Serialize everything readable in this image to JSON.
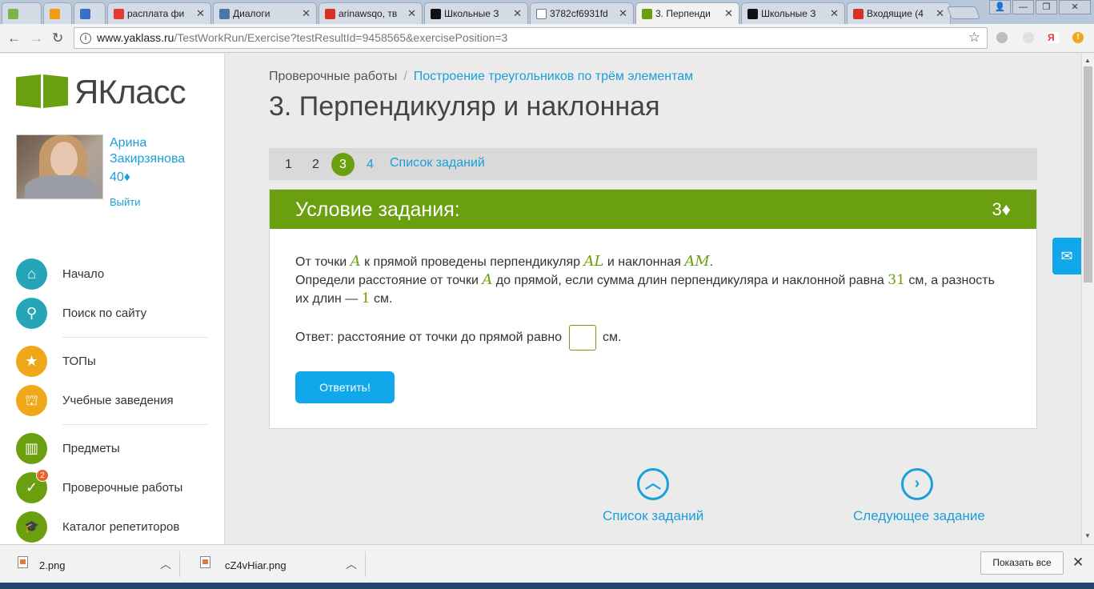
{
  "browser": {
    "tabs": [
      {
        "title": "",
        "color": "#7fb24a"
      },
      {
        "title": "",
        "color": "#f39c12"
      },
      {
        "title": "",
        "color": "#3b6fc4"
      },
      {
        "title": "расплата фи",
        "color": "#e53935"
      },
      {
        "title": "Диалоги",
        "color": "#4a76a8"
      },
      {
        "title": "arinawsqo, тв",
        "color": "#d93025"
      },
      {
        "title": "Школьные З",
        "color": "#111111"
      },
      {
        "title": "3782cf6931fd",
        "color": "#ffffff"
      },
      {
        "title": "3. Перпенди",
        "color": "#6aa00f"
      },
      {
        "title": "Школьные З",
        "color": "#111111"
      },
      {
        "title": "Входящие (4",
        "color": "#d93025"
      }
    ],
    "close_glyph": "✕",
    "url_host": "www.yaklass.ru",
    "url_path": "/TestWorkRun/Exercise?testResultId=9458565&exercisePosition=3",
    "window_controls": [
      "👤",
      "—",
      "❐",
      "✕"
    ]
  },
  "sidebar": {
    "brand": "ЯКласс",
    "user_name": "Арина Закирзянова",
    "user_coins": "40♦",
    "logout": "Выйти",
    "menu": [
      {
        "label": "Начало",
        "icon": "home-icon",
        "glyph": "⌂",
        "color": "#26a5b8"
      },
      {
        "label": "Поиск по сайту",
        "icon": "search-icon",
        "glyph": "⚲",
        "color": "#26a5b8"
      },
      {
        "label": "ТОПы",
        "icon": "star-icon",
        "glyph": "★",
        "color": "#f0a81a"
      },
      {
        "label": "Учебные заведения",
        "icon": "institution-icon",
        "glyph": "⛫",
        "color": "#f0a81a"
      },
      {
        "label": "Предметы",
        "icon": "book-icon",
        "glyph": "▥",
        "color": "#6aa00f"
      },
      {
        "label": "Проверочные работы",
        "icon": "check-icon",
        "glyph": "✓",
        "color": "#6aa00f",
        "badge": "2"
      },
      {
        "label": "Каталог репетиторов",
        "icon": "graduation-cap-icon",
        "glyph": "🎓",
        "color": "#6aa00f"
      }
    ]
  },
  "main": {
    "breadcrumb_root": "Проверочные работы",
    "breadcrumb_sep": "/",
    "breadcrumb_current": "Построение треугольников по трём элементам",
    "title": "3. Перпендикуляр и наклонная",
    "pager": {
      "pages": [
        "1",
        "2",
        "3",
        "4"
      ],
      "current": "3",
      "list_label": "Список заданий"
    },
    "card": {
      "header": "Условие задания:",
      "points": "3♦",
      "text": {
        "p1_a": "От точки ",
        "var_A": "A",
        "p1_b": " к прямой проведены перпендикуляр ",
        "var_AL": "AL",
        "p1_c": " и наклонная ",
        "var_AM": "AM",
        "p1_d": ".",
        "p2_a": "Определи расстояние от точки ",
        "p2_b": " до прямой, если сумма длин перпендикуляра и наклонной равна ",
        "num_31": "31",
        "p2_c": " см, а разность их длин — ",
        "num_1": "1",
        "p2_d": " см."
      },
      "answer_prefix": "Ответ: расстояние от точки до прямой равно",
      "answer_value": "",
      "answer_suffix": "см.",
      "submit": "Ответить!"
    },
    "nav_list": "Список заданий",
    "nav_next": "Следующее задание"
  },
  "downloads": {
    "items": [
      {
        "name": "2.png"
      },
      {
        "name": "cZ4vHiar.png"
      }
    ],
    "show_all": "Показать все"
  }
}
